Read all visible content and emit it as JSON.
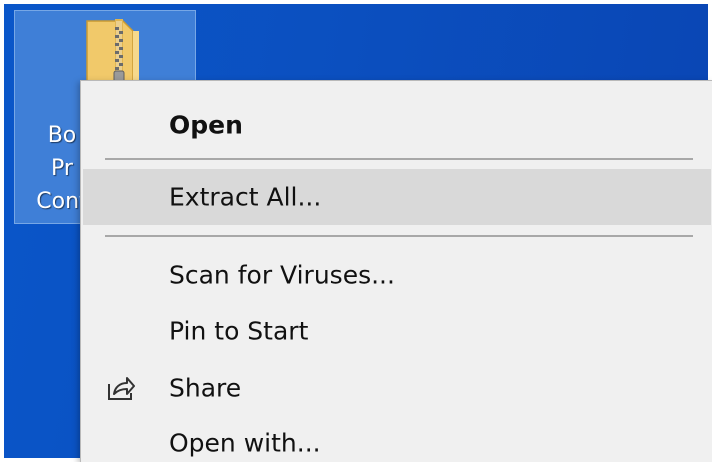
{
  "desktop": {
    "wallpaper_color": "#0b4fbf",
    "selected_icon": {
      "icon": "zip-folder-icon",
      "label_lines": [
        "Bo",
        "Pr",
        "Cont"
      ]
    }
  },
  "context_menu": {
    "items": [
      {
        "label": "Open",
        "bold": true
      },
      {
        "label": "Extract All...",
        "highlighted": true
      },
      {
        "label": "Scan for Viruses..."
      },
      {
        "label": "Pin to Start"
      },
      {
        "label": "Share",
        "icon": "share-icon"
      },
      {
        "label": "Open with..."
      }
    ],
    "highlight_color": "#d9d9d9",
    "background_color": "#f0f0f0"
  }
}
